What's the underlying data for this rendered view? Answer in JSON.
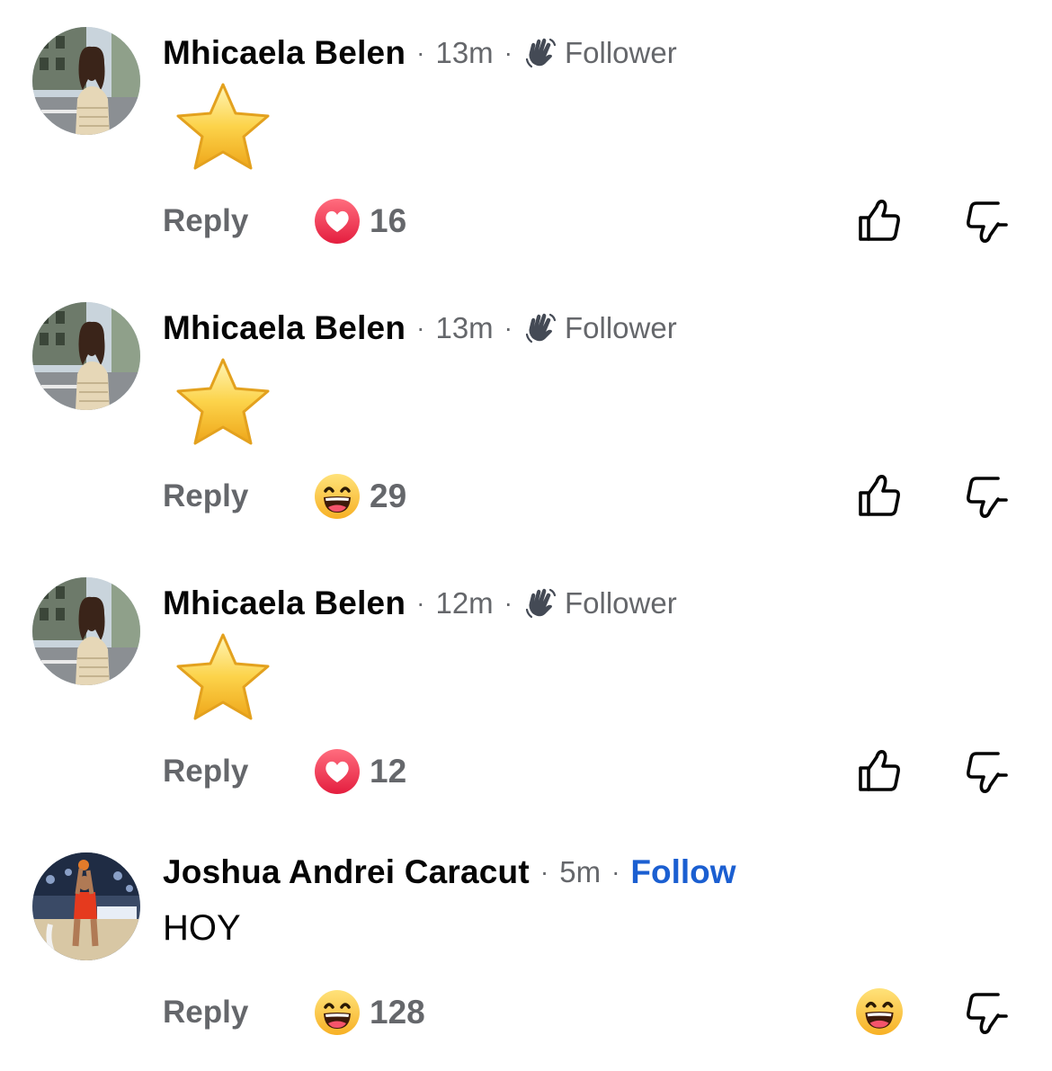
{
  "comments": [
    {
      "author": "Mhicaela Belen",
      "time": "13m",
      "badge_icon": "wave-hand-icon",
      "badge_label": "Follower",
      "content_icon": "star-emoji",
      "reply_label": "Reply",
      "reaction_icon": "love-reaction-icon",
      "reaction_count": "16",
      "like_icon": "thumbs-up-icon",
      "dislike_icon": "thumbs-down-icon"
    },
    {
      "author": "Mhicaela Belen",
      "time": "13m",
      "badge_icon": "wave-hand-icon",
      "badge_label": "Follower",
      "content_icon": "star-emoji",
      "reply_label": "Reply",
      "reaction_icon": "haha-reaction-icon",
      "reaction_count": "29",
      "like_icon": "thumbs-up-icon",
      "dislike_icon": "thumbs-down-icon"
    },
    {
      "author": "Mhicaela Belen",
      "time": "12m",
      "badge_icon": "wave-hand-icon",
      "badge_label": "Follower",
      "content_icon": "star-emoji",
      "reply_label": "Reply",
      "reaction_icon": "love-reaction-icon",
      "reaction_count": "12",
      "like_icon": "thumbs-up-icon",
      "dislike_icon": "thumbs-down-icon"
    },
    {
      "author": "Joshua Andrei Caracut",
      "time": "5m",
      "follow_label": "Follow",
      "text": "HOY",
      "reply_label": "Reply",
      "reaction_icon": "haha-reaction-icon",
      "reaction_count": "128",
      "user_reaction_icon": "haha-reaction-icon",
      "dislike_icon": "thumbs-down-icon"
    }
  ],
  "colors": {
    "text_primary": "#050505",
    "text_secondary": "#65676b",
    "follow_blue": "#1b5fd1",
    "love_red": "#f0284a",
    "haha_yellow": "#fcc63e"
  }
}
